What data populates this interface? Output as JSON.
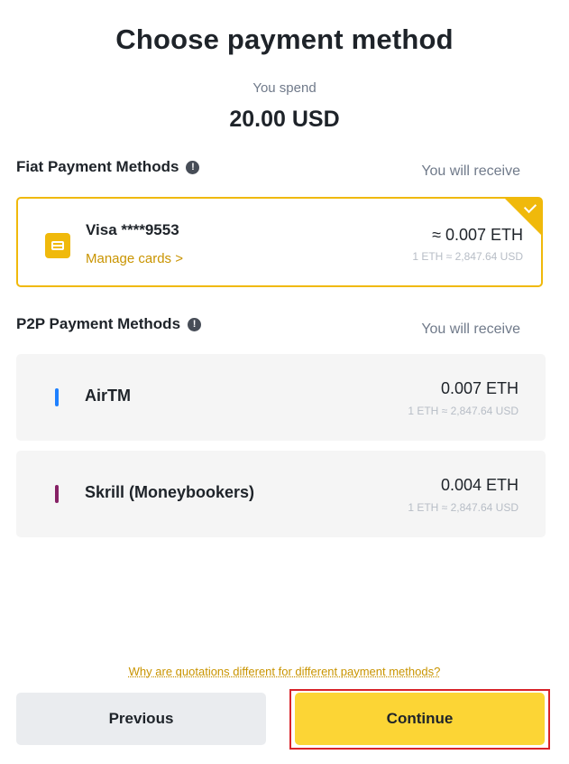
{
  "header": {
    "title": "Choose payment method",
    "spend_label": "You spend",
    "spend_amount": "20.00 USD"
  },
  "fiat": {
    "section_title": "Fiat Payment Methods",
    "receive_label": "You will receive",
    "card": {
      "label": "Visa ****9553",
      "manage_link": "Manage cards >",
      "amount": "≈ 0.007 ETH",
      "rate": "1 ETH ≈ 2,847.64 USD",
      "selected": true
    }
  },
  "p2p": {
    "section_title": "P2P Payment Methods",
    "receive_label": "You will receive",
    "methods": [
      {
        "name": "AirTM",
        "amount": "0.007 ETH",
        "rate": "1 ETH ≈ 2,847.64 USD",
        "color": "#1e80ff"
      },
      {
        "name": "Skrill (Moneybookers)",
        "amount": "0.004 ETH",
        "rate": "1 ETH ≈ 2,847.64 USD",
        "color": "#862165"
      }
    ]
  },
  "footer": {
    "why_link": "Why are quotations different for different payment methods?",
    "previous_label": "Previous",
    "continue_label": "Continue"
  },
  "colors": {
    "accent": "#f0b90b",
    "continue_bg": "#fcd535",
    "highlight_outline": "#d8232a"
  },
  "icons": {
    "info": "info-icon",
    "card": "credit-card-icon",
    "check": "check-icon"
  }
}
